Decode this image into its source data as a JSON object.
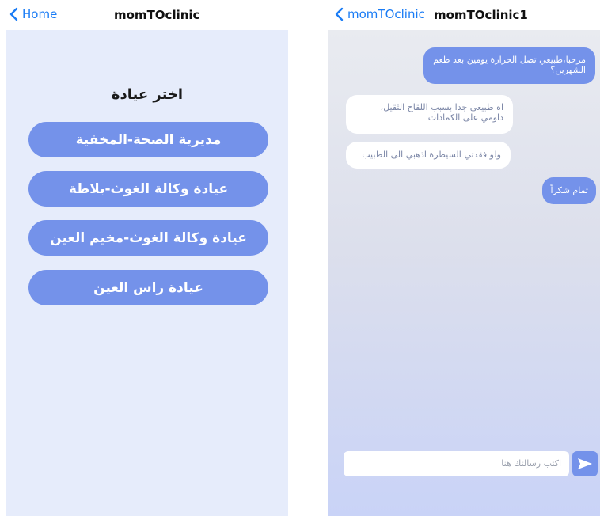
{
  "left_screen": {
    "nav": {
      "back_label": "Home",
      "title": "momTOclinic"
    },
    "heading": "اختر عيادة",
    "clinics": [
      "مديرية الصحة-المخفية",
      "عيادة وكالة الغوث-بلاطة",
      "عيادة وكالة الغوث-مخيم العين",
      "عيادة راس العين"
    ]
  },
  "right_screen": {
    "nav": {
      "back_label": "momTOclinic",
      "title": "momTOclinic1"
    },
    "messages": [
      {
        "direction": "outgoing",
        "text": "مرحبا،طبيعي تضل الحرارة يومين بعد طعم الشهرين؟"
      },
      {
        "direction": "incoming",
        "text": "اه طبيعي جدا بسبب اللقاح الثقيل، داومي على الكمادات"
      },
      {
        "direction": "incoming",
        "text": "ولو فقدتي السيطرة اذهبي الى الطبيب"
      },
      {
        "direction": "outgoing",
        "text": "تمام شكراً"
      }
    ],
    "composer": {
      "placeholder": "اكتب رسالتك هنا"
    }
  },
  "colors": {
    "accent": "#1a7cf5",
    "bubble_outgoing": "#7492ea",
    "button_fill": "#7492ea",
    "left_background": "#e6ecfb"
  },
  "icons": {
    "back": "chevron-left-icon",
    "send": "send-arrow-icon"
  }
}
